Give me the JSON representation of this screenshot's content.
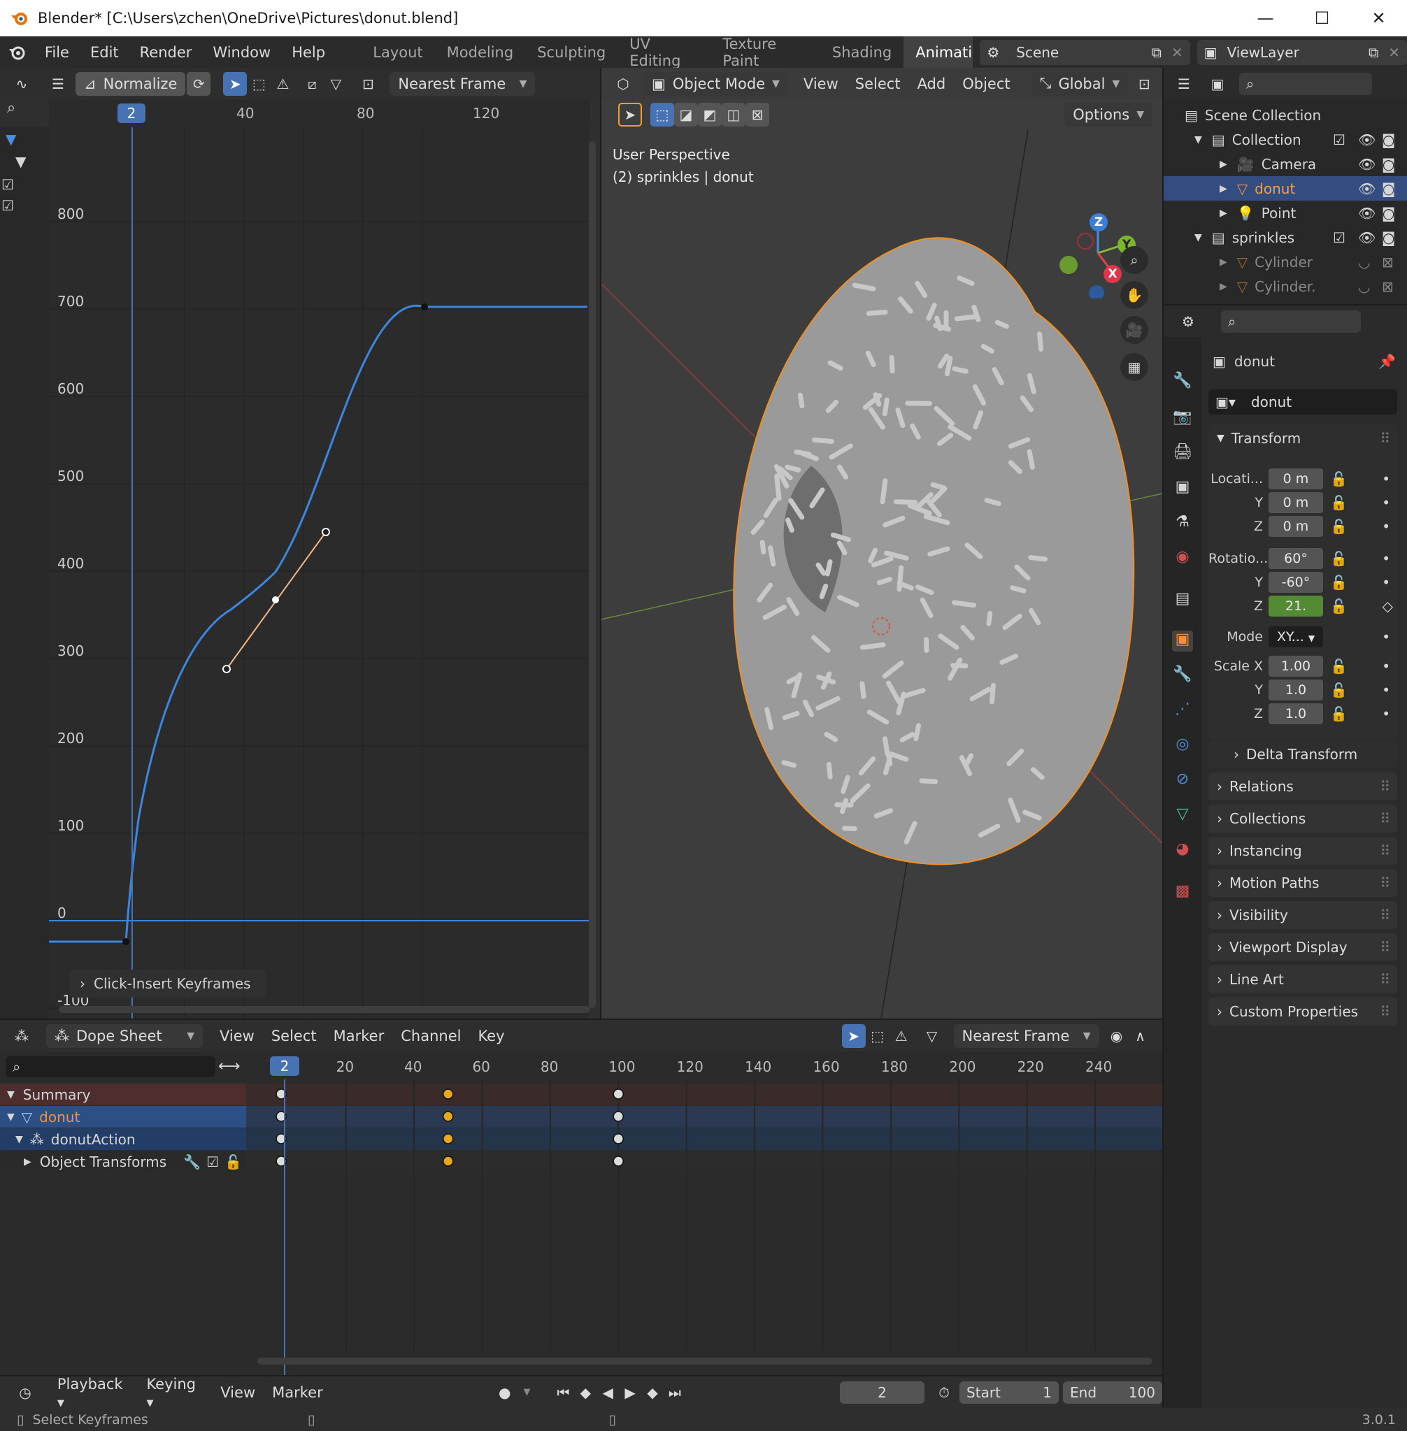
{
  "window": {
    "title": "Blender* [C:\\Users\\zchen\\OneDrive\\Pictures\\donut.blend]",
    "minimize": "—",
    "maximize": "☐",
    "close": "✕"
  },
  "topbar": {
    "menus": [
      "File",
      "Edit",
      "Render",
      "Window",
      "Help"
    ],
    "workspaces": [
      "Layout",
      "Modeling",
      "Sculpting",
      "UV Editing",
      "Texture Paint",
      "Shading",
      "Animation"
    ],
    "active_workspace": "Animation",
    "scene": "Scene",
    "view_layer": "ViewLayer"
  },
  "graph_editor": {
    "normalize_label": "Normalize",
    "snap_mode": "Nearest Frame",
    "current_frame": "2",
    "ruler_ticks": [
      "40",
      "80",
      "120"
    ],
    "y_ticks": [
      "800",
      "700",
      "600",
      "500",
      "400",
      "300",
      "200",
      "100",
      "0",
      "-100"
    ],
    "last_operator": "Click-Insert Keyframes"
  },
  "viewport": {
    "mode": "Object Mode",
    "menus": [
      "View",
      "Select",
      "Add",
      "Object"
    ],
    "orientation": "Global",
    "options_label": "Options",
    "perspective": "User Perspective",
    "context": "(2) sprinkles | donut",
    "gizmo": {
      "z": "Z",
      "y": "Y",
      "x": "X"
    }
  },
  "outliner": {
    "root": "Scene Collection",
    "items": [
      {
        "label": "Collection"
      },
      {
        "label": "Camera"
      },
      {
        "label": "donut"
      },
      {
        "label": "Point"
      },
      {
        "label": "sprinkles"
      },
      {
        "label": "Cylinder"
      },
      {
        "label": "Cylinder."
      }
    ]
  },
  "properties": {
    "object_name": "donut",
    "data_name": "donut",
    "transform_label": "Transform",
    "location_label": "Locati...",
    "location": [
      "0 m",
      "0 m",
      "0 m"
    ],
    "rotation_label": "Rotatio...",
    "rotation": [
      "60°",
      "-60°",
      "21."
    ],
    "mode_label": "Mode",
    "mode_value": "XY...",
    "scale_label": "Scale X",
    "scale": [
      "1.00",
      "1.0",
      "1.0"
    ],
    "axis_y": "Y",
    "axis_z": "Z",
    "delta_label": "Delta Transform",
    "panels": [
      "Relations",
      "Collections",
      "Instancing",
      "Motion Paths",
      "Visibility",
      "Viewport Display",
      "Line Art",
      "Custom Properties"
    ]
  },
  "dopesheet": {
    "mode": "Dope Sheet",
    "menus": [
      "View",
      "Select",
      "Marker",
      "Channel",
      "Key"
    ],
    "snap_mode": "Nearest Frame",
    "current_frame": "2",
    "ruler_ticks": [
      "20",
      "40",
      "60",
      "80",
      "100",
      "120",
      "140",
      "160",
      "180",
      "200",
      "220",
      "240"
    ],
    "channels": [
      "Summary",
      "donut",
      "donutAction",
      "Object Transforms"
    ]
  },
  "timeline": {
    "menus": [
      "Playback",
      "Keying",
      "View",
      "Marker"
    ],
    "current_frame": "2",
    "start_label": "Start",
    "start": "1",
    "end_label": "End",
    "end": "100"
  },
  "status": {
    "hint": "Select Keyframes",
    "version": "3.0.1"
  },
  "colors": {
    "accent": "#4772b3",
    "curve": "#3d86e0",
    "keyframe": "#e8a81c",
    "selected_outline": "#f28f21"
  }
}
